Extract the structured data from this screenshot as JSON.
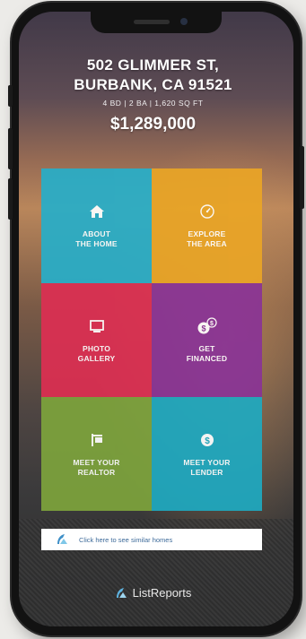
{
  "listing": {
    "address_line1": "502 GLIMMER ST,",
    "address_line2": "BURBANK, CA 91521",
    "specs": "4 BD | 2 BA | 1,620 SQ FT",
    "price": "$1,289,000"
  },
  "tiles": [
    {
      "line1": "ABOUT",
      "line2": "THE HOME",
      "color": "#28aec8",
      "icon": "house-icon"
    },
    {
      "line1": "EXPLORE",
      "line2": "THE AREA",
      "color": "#e9a526",
      "icon": "compass-icon"
    },
    {
      "line1": "PHOTO",
      "line2": "GALLERY",
      "color": "#dc2f52",
      "icon": "monitor-icon"
    },
    {
      "line1": "GET",
      "line2": "FINANCED",
      "color": "#8a3496",
      "icon": "coins-icon"
    },
    {
      "line1": "MEET YOUR",
      "line2": "REALTOR",
      "color": "#7da33c",
      "icon": "sign-icon"
    },
    {
      "line1": "MEET YOUR",
      "line2": "LENDER",
      "color": "#1fa9c0",
      "icon": "dollar-icon"
    }
  ],
  "cta": {
    "text": "Click here to see similar homes"
  },
  "brand": {
    "name": "ListReports"
  }
}
